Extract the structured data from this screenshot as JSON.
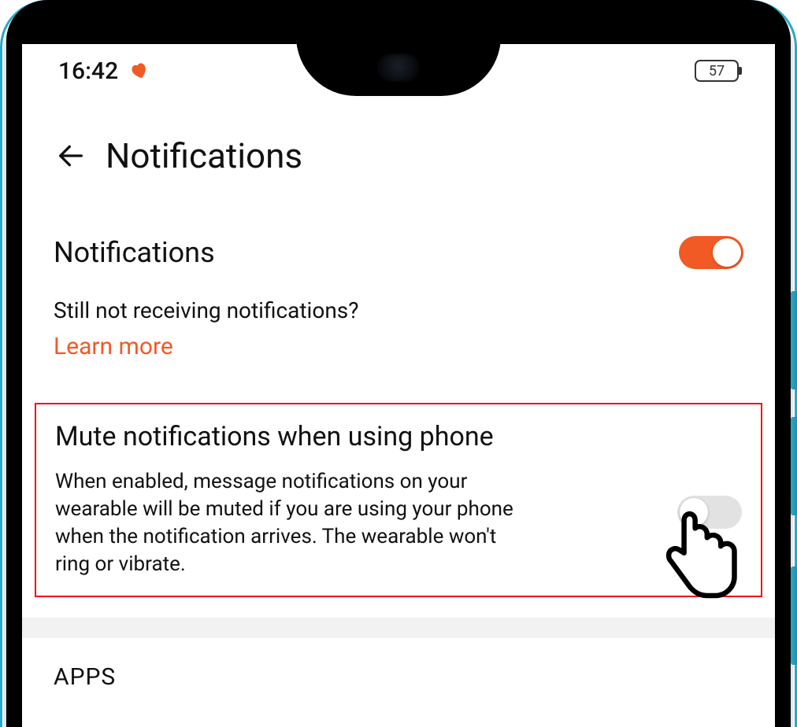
{
  "status": {
    "time": "16:42",
    "battery": "57"
  },
  "header": {
    "title": "Notifications"
  },
  "notifications": {
    "label": "Notifications",
    "help_text": "Still not receiving notifications?",
    "learn_more": "Learn more"
  },
  "mute": {
    "title": "Mute notifications when using phone",
    "description": "When enabled, message notifications on your wearable will be muted if you are using your phone when the notification arrives. The wearable won't ring or vibrate."
  },
  "sections": {
    "apps": "APPS"
  },
  "icons": {
    "heart": "heart-icon",
    "back": "back-arrow-icon",
    "hand": "pointing-hand-icon"
  },
  "colors": {
    "accent": "#f15a24",
    "highlight_border": "#e11"
  }
}
